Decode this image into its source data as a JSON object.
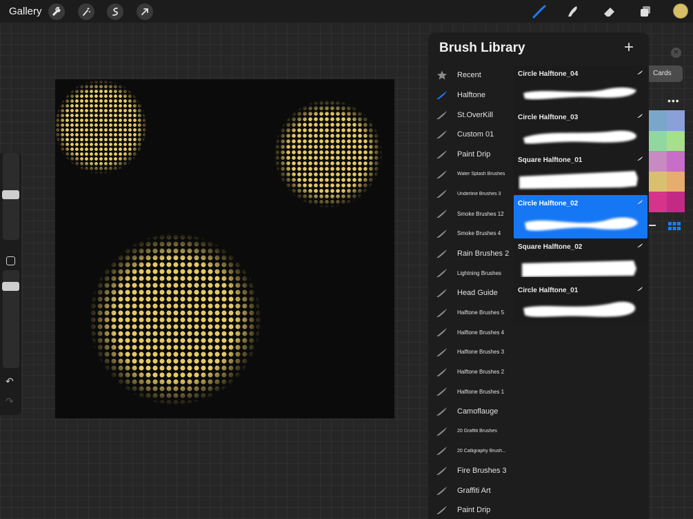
{
  "topbar": {
    "gallery_label": "Gallery",
    "tools": [
      "wrench-icon",
      "magic-wand-icon",
      "selection-icon",
      "transform-arrow-icon"
    ],
    "right_tools": [
      "brush-icon",
      "smudge-icon",
      "eraser-icon",
      "layers-icon"
    ],
    "active_color": "#d7bf67"
  },
  "brush_library": {
    "title": "Brush Library",
    "add_label": "+",
    "sets": [
      {
        "label": "Recent",
        "icon": "star-icon"
      },
      {
        "label": "Halftone",
        "icon": "brush-stroke-icon",
        "active": true
      },
      {
        "label": "St.OverKill",
        "icon": "brush-stroke-icon"
      },
      {
        "label": "Custom 01",
        "icon": "brush-stroke-icon"
      },
      {
        "label": "Paint Drip",
        "icon": "brush-stroke-icon"
      },
      {
        "label": "Water Splash Brushes",
        "icon": "brush-stroke-icon"
      },
      {
        "label": "Underline Brushes 3",
        "icon": "brush-stroke-icon"
      },
      {
        "label": "Smoke Brushes 12",
        "icon": "brush-stroke-icon"
      },
      {
        "label": "Smoke Brushes 4",
        "icon": "brush-stroke-icon"
      },
      {
        "label": "Rain Brushes 2",
        "icon": "brush-stroke-icon"
      },
      {
        "label": "Lightning Brushes",
        "icon": "brush-stroke-icon"
      },
      {
        "label": "Head Guide",
        "icon": "brush-stroke-icon"
      },
      {
        "label": "Halftone Brushes 5",
        "icon": "brush-stroke-icon"
      },
      {
        "label": "Halftone Brushes 4",
        "icon": "brush-stroke-icon"
      },
      {
        "label": "Halftone Brushes 3",
        "icon": "brush-stroke-icon"
      },
      {
        "label": "Halftone Brushes 2",
        "icon": "brush-stroke-icon"
      },
      {
        "label": "Halftone Brushes 1",
        "icon": "brush-stroke-icon"
      },
      {
        "label": "Camoflauge",
        "icon": "brush-stroke-icon"
      },
      {
        "label": "20 Graffiti Brushes",
        "icon": "brush-stroke-icon"
      },
      {
        "label": "20 Calligraphy Brush...",
        "icon": "brush-stroke-icon"
      },
      {
        "label": "Fire Brushes 3",
        "icon": "brush-stroke-icon"
      },
      {
        "label": "Graffiti Art",
        "icon": "brush-stroke-icon"
      },
      {
        "label": "Paint Drip",
        "icon": "brush-stroke-icon"
      }
    ],
    "brushes": [
      {
        "name": "Circle Halftone_04",
        "selected": false
      },
      {
        "name": "Circle Halftone_03",
        "selected": false
      },
      {
        "name": "Square Halftone_01",
        "selected": false
      },
      {
        "name": "Circle Halftone_02",
        "selected": true
      },
      {
        "name": "Square Halftone_02",
        "selected": false
      },
      {
        "name": "Circle Halftone_01",
        "selected": false
      }
    ]
  },
  "color_panel": {
    "tab_label": "Cards",
    "more_label": "•••",
    "palette": [
      [
        "#7aa7c9",
        "#8aa0d8"
      ],
      [
        "#8fd9a0",
        "#a6e08a"
      ],
      [
        "#c88ac0",
        "#c86ec8"
      ],
      [
        "#d8c070",
        "#e7ad6c"
      ],
      [
        "#d6348a",
        "#c22a86"
      ]
    ]
  },
  "sidebar": {
    "undo_label": "↶",
    "redo_label": "↷"
  }
}
